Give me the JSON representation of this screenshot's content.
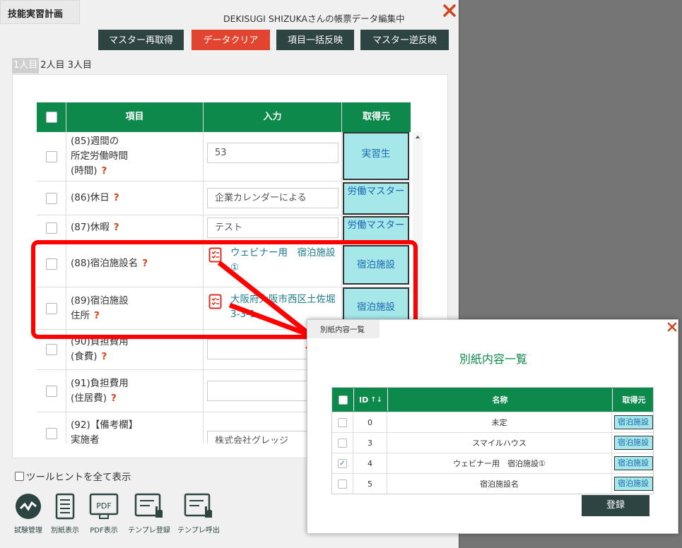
{
  "dialog": {
    "title": "技能実習計画",
    "editing_label": "DEKISUGI SHIZUKAさんの帳票データ編集中",
    "buttons": {
      "refetch_master": "マスター再取得",
      "clear_data": "データクリア",
      "bulk_reflect": "項目一括反映",
      "reverse_master": "マスター逆反映"
    },
    "tabs": [
      "1人目",
      "2人目",
      "3人目"
    ]
  },
  "grid": {
    "headers": {
      "item": "項目",
      "input": "入力",
      "source": "取得元"
    },
    "rows": [
      {
        "label_lines": [
          "(85)週間の",
          "所定労働時間",
          "(時間)"
        ],
        "value": "53",
        "source": "実習生",
        "help": "?"
      },
      {
        "label_lines": [
          "(86)休日"
        ],
        "value": "企業カレンダーによる",
        "source": "労働マスター",
        "help": "?"
      },
      {
        "label_lines": [
          "(87)休暇"
        ],
        "value": "テスト",
        "source": "労働マスター",
        "help": "?"
      },
      {
        "label_lines": [
          "(88)宿泊施設名"
        ],
        "value": "ウェビナー用　宿泊施設①",
        "source": "宿泊施設",
        "help": "?"
      },
      {
        "label_lines": [
          "(89)宿泊施設",
          "住所"
        ],
        "value": "大阪府大阪市西区土佐堀3-3-1",
        "source": "宿泊施設",
        "help": "?"
      },
      {
        "label_lines": [
          "(90)負担費用",
          "(食費)"
        ],
        "value": "",
        "source": "",
        "help": "?"
      },
      {
        "label_lines": [
          "(91)負担費用",
          "(住居費)"
        ],
        "value": "",
        "source": "",
        "help": "?"
      },
      {
        "label_lines": [
          "(92)【備考欄】",
          "実施者"
        ],
        "value": "株式会社グレッジ",
        "source": "",
        "help": ""
      }
    ]
  },
  "footer": {
    "tooltip_label": "ツールヒントを全て表示",
    "icons": [
      "試験管理",
      "別紙表示",
      "PDF表示",
      "テンプレ登録",
      "テンプレ呼出"
    ]
  },
  "popup": {
    "tab_label": "別紙内容一覧",
    "title": "別紙内容一覧",
    "headers": {
      "id": "ID",
      "name": "名称",
      "source": "取得元"
    },
    "rows": [
      {
        "id": "0",
        "name": "未定",
        "source": "宿泊施設",
        "checked": false
      },
      {
        "id": "3",
        "name": "スマイルハウス",
        "source": "宿泊施設",
        "checked": false
      },
      {
        "id": "4",
        "name": "ウェビナー用　宿泊施設①",
        "source": "宿泊施設",
        "checked": true
      },
      {
        "id": "5",
        "name": "宿泊施設名",
        "source": "宿泊施設",
        "checked": false
      }
    ],
    "register_label": "登録"
  },
  "colors": {
    "green": "#0d8a4b",
    "dark": "#2d4443",
    "red": "#e2452f",
    "source_bg": "#a6e8ea",
    "highlight": "#ff0000"
  }
}
